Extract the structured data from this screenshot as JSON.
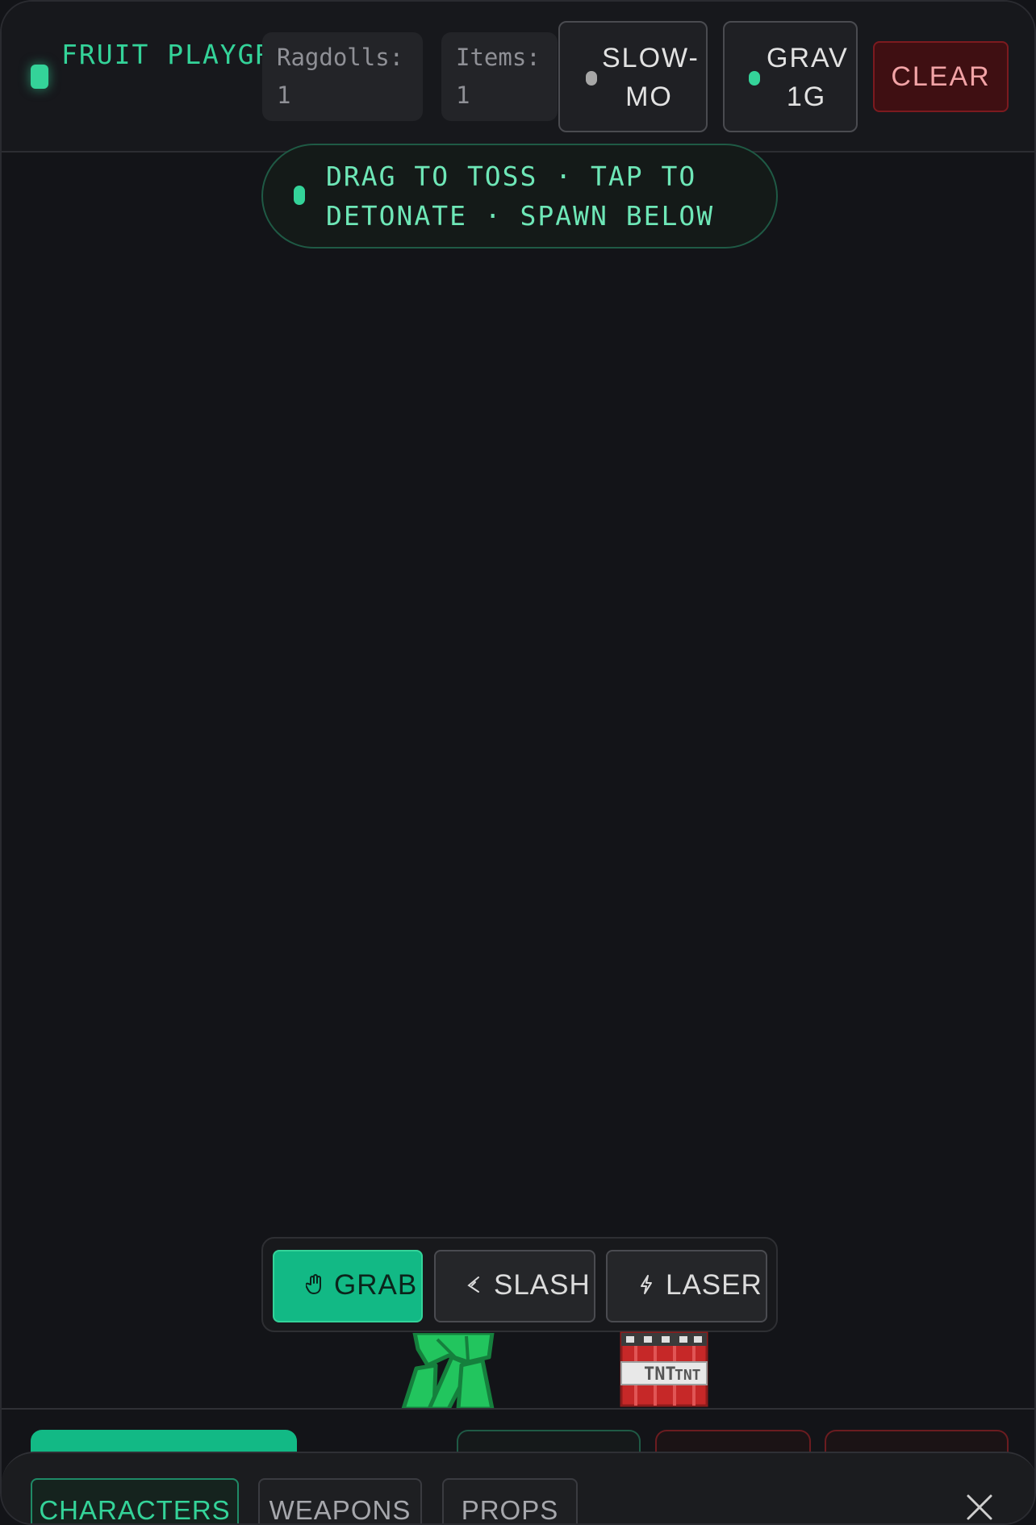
{
  "header": {
    "brand": "FRUIT PLAYGROUND",
    "stats": [
      {
        "label": "Ragdolls:",
        "value": "1"
      },
      {
        "label": "Items:",
        "value": "1"
      }
    ],
    "slowmo_label": "SLOW-MO",
    "slowmo_active": false,
    "gravity_label": "GRAV 1G",
    "gravity_active": true,
    "clear_label": "CLEAR"
  },
  "hint": {
    "text": "DRAG TO TOSS · TAP TO DETONATE · SPAWN BELOW"
  },
  "tools": {
    "active": "grab",
    "items": [
      {
        "id": "grab",
        "label": "GRAB",
        "icon": "hand-icon"
      },
      {
        "id": "slash",
        "label": "SLASH",
        "icon": "slash-icon"
      },
      {
        "id": "laser",
        "label": "LASER",
        "icon": "bolt-icon"
      }
    ]
  },
  "scene": {
    "ragdoll_color": "#22c55e",
    "tnt_label": "TNT"
  },
  "drawer": {
    "tabs": [
      {
        "id": "characters",
        "label": "CHARACTERS",
        "active": true
      },
      {
        "id": "weapons",
        "label": "WEAPONS",
        "active": false
      },
      {
        "id": "props",
        "label": "PROPS",
        "active": false
      }
    ],
    "close_icon": "close-icon"
  },
  "colors": {
    "accent": "#34d399",
    "background": "#131418",
    "danger": "#7c1a1f"
  }
}
